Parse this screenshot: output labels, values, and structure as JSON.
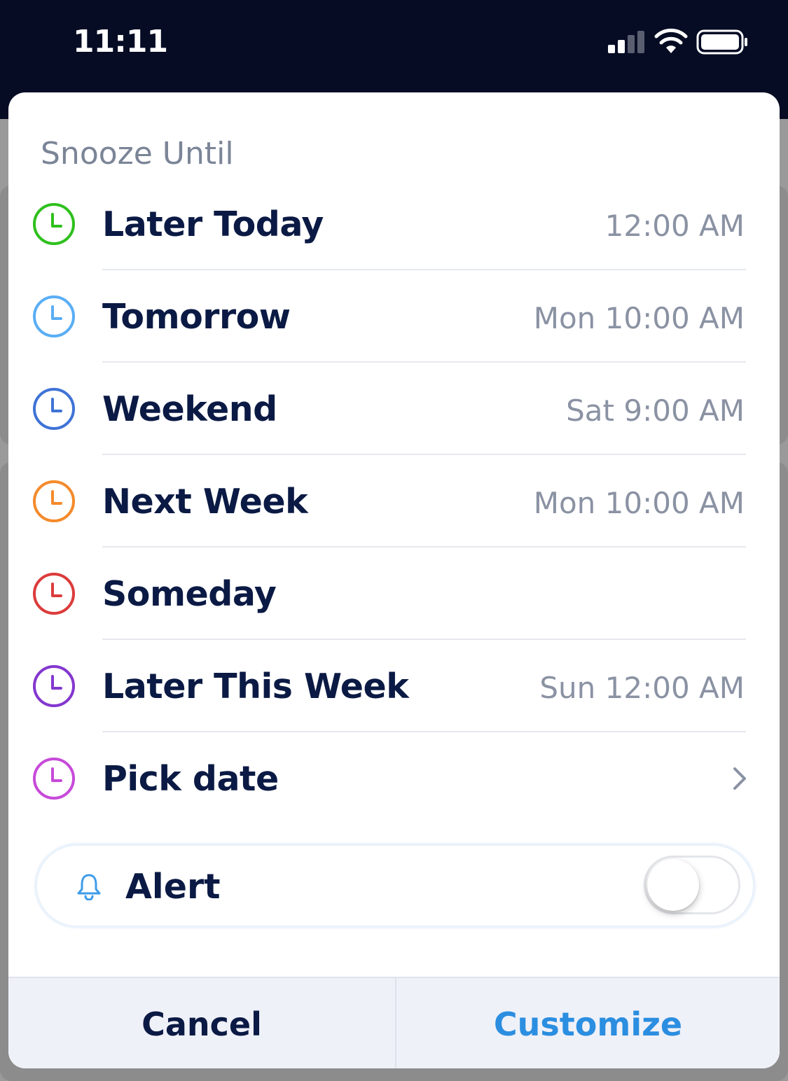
{
  "status_bar": {
    "time": "11:11",
    "signal_icon": "cellular-signal-icon",
    "wifi_icon": "wifi-icon",
    "battery_icon": "battery-icon"
  },
  "sheet": {
    "title": "Snooze Until",
    "options": [
      {
        "label": "Later Today",
        "time": "12:00 AM",
        "color": "#2fc01d",
        "icon": "clock-icon"
      },
      {
        "label": "Tomorrow",
        "time": "Mon 10:00 AM",
        "color": "#5aaef5",
        "icon": "clock-icon"
      },
      {
        "label": "Weekend",
        "time": "Sat 9:00 AM",
        "color": "#3f73d6",
        "icon": "clock-icon"
      },
      {
        "label": "Next Week",
        "time": "Mon 10:00 AM",
        "color": "#f48a2b",
        "icon": "clock-icon"
      },
      {
        "label": "Someday",
        "time": "",
        "color": "#dc3b3b",
        "icon": "clock-icon"
      },
      {
        "label": "Later This Week",
        "time": "Sun 12:00 AM",
        "color": "#8437cf",
        "icon": "clock-icon"
      },
      {
        "label": "Pick date",
        "time": "",
        "color": "#c74ad9",
        "icon": "clock-icon",
        "chevron": "chevron-right-icon"
      }
    ],
    "alert": {
      "label": "Alert",
      "icon": "bell-icon",
      "icon_color": "#3d9be9",
      "enabled": false
    }
  },
  "footer": {
    "cancel_label": "Cancel",
    "customize_label": "Customize",
    "customize_color": "#2b8ee0"
  }
}
